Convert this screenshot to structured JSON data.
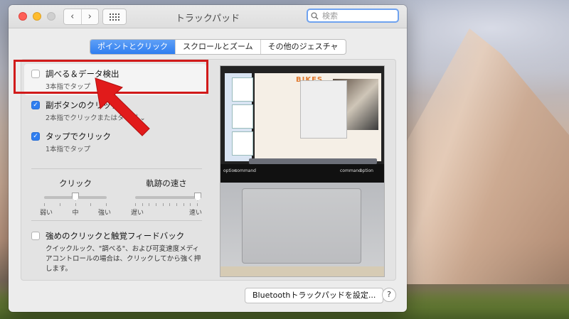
{
  "window": {
    "title": "トラックパッド",
    "search_placeholder": "検索"
  },
  "tabs": [
    {
      "label": "ポイントとクリック",
      "active": true
    },
    {
      "label": "スクロールとズーム",
      "active": false
    },
    {
      "label": "その他のジェスチャ",
      "active": false
    }
  ],
  "options": [
    {
      "title": "調べる＆データ検出",
      "subtitle": "3本指でタップ",
      "checked": false
    },
    {
      "title": "副ボタンのクリック",
      "subtitle": "2本指でクリックまたはタップ",
      "checked": true
    },
    {
      "title": "タップでクリック",
      "subtitle": "1本指でタップ",
      "checked": true
    }
  ],
  "sliders": [
    {
      "title": "クリック",
      "labels": [
        "弱い",
        "中",
        "強い"
      ],
      "value": 0.5
    },
    {
      "title": "軌跡の速さ",
      "labels": [
        "遅い",
        "速い"
      ],
      "value": 1.0
    }
  ],
  "force_click": {
    "title": "強めのクリックと触覚フィードバック",
    "description": "クイックルック、\"調べる\"、および可変速度メディアコントロールの場合は、クリックしてから強く押します。",
    "checked": false
  },
  "preview": {
    "doc_title": "BIKES",
    "keys": [
      "option",
      "command",
      "command",
      "option"
    ]
  },
  "footer": {
    "bluetooth_button": "Bluetoothトラックパッドを設定...",
    "help_label": "?"
  },
  "colors": {
    "accent": "#2f7ef0",
    "annotation_red": "#d11a1a"
  }
}
